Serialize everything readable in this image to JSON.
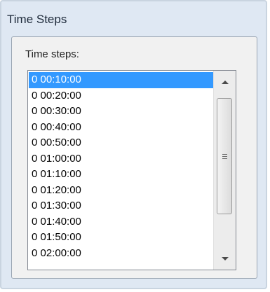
{
  "window": {
    "title": "Time Steps"
  },
  "group": {
    "label": "Time steps:"
  },
  "list": {
    "items": [
      "0 00:10:00",
      "0 00:20:00",
      "0 00:30:00",
      "0 00:40:00",
      "0 00:50:00",
      "0 01:00:00",
      "0 01:10:00",
      "0 01:20:00",
      "0 01:30:00",
      "0 01:40:00",
      "0 01:50:00",
      "0 02:00:00"
    ],
    "selected_index": 0
  },
  "colors": {
    "selection": "#3399ff",
    "window_bg": "#dfe8f3"
  },
  "icons": {
    "scroll_up": "chevron-up-icon",
    "scroll_down": "chevron-down-icon",
    "thumb_grip": "grip-icon"
  }
}
